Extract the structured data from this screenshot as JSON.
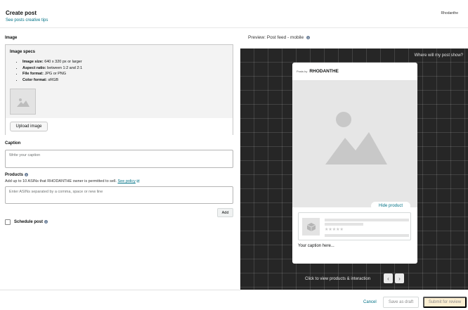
{
  "header": {
    "title": "Create post",
    "tips_link": "See posts creative tips",
    "brand": "Rhodanthe"
  },
  "form": {
    "image_label": "Image",
    "specs": {
      "title": "Image specs",
      "items": [
        {
          "key": "Image size:",
          "value": "640 x 320 px or larger"
        },
        {
          "key": "Aspect ratio:",
          "value": "between 1:2 and 2:1"
        },
        {
          "key": "File format:",
          "value": "JPG or PNG"
        },
        {
          "key": "Color format:",
          "value": "sRGB"
        }
      ]
    },
    "upload_button": "Upload image",
    "caption_label": "Caption",
    "caption_placeholder": "Write your caption",
    "products_label": "Products",
    "products_help": "Add up to 10 ASINs that RHODANTHE owner is permitted to sell.",
    "products_help_link": "See policy",
    "asin_placeholder": "Enter ASINs separated by a comma, space or new line",
    "add_button": "Add",
    "schedule_label": "Schedule post"
  },
  "preview": {
    "label": "Preview: Post feed - mobile",
    "where_link": "Where will my post show?",
    "phone": {
      "by_text": "Posts by",
      "brand": "RHODANTHE",
      "hide_product": "Hide product",
      "caption": "Your caption here..."
    },
    "click_text": "Click to view products & interaction"
  },
  "footer": {
    "cancel": "Cancel",
    "save_draft": "Save as draft",
    "submit": "Submit for review"
  },
  "colors": {
    "link": "#007185",
    "canvas": "#262626",
    "submit_bg": "#fcefd2"
  },
  "icons": {
    "preview_info": "info-icon",
    "external_link": "external-link-icon",
    "image_placeholder": "mountain-image-icon",
    "product_placeholder": "box-icon",
    "prev": "chevron-left-icon",
    "next": "chevron-right-icon"
  }
}
